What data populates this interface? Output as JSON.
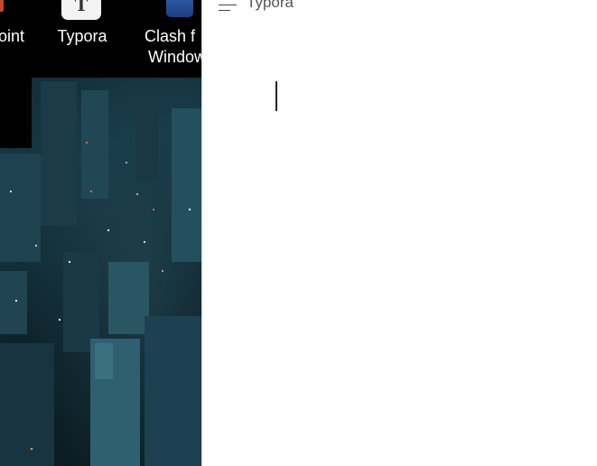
{
  "desktop": {
    "icons": [
      {
        "label": "oint"
      },
      {
        "label": "Typora"
      },
      {
        "label_line1": "Clash f",
        "label_line2": "Window"
      }
    ]
  },
  "typora_window": {
    "title": "Typora",
    "document_text": ""
  },
  "colors": {
    "wallpaper_dark": "#0f2630",
    "editor_background": "#ffffff",
    "title_text": "#555555"
  }
}
